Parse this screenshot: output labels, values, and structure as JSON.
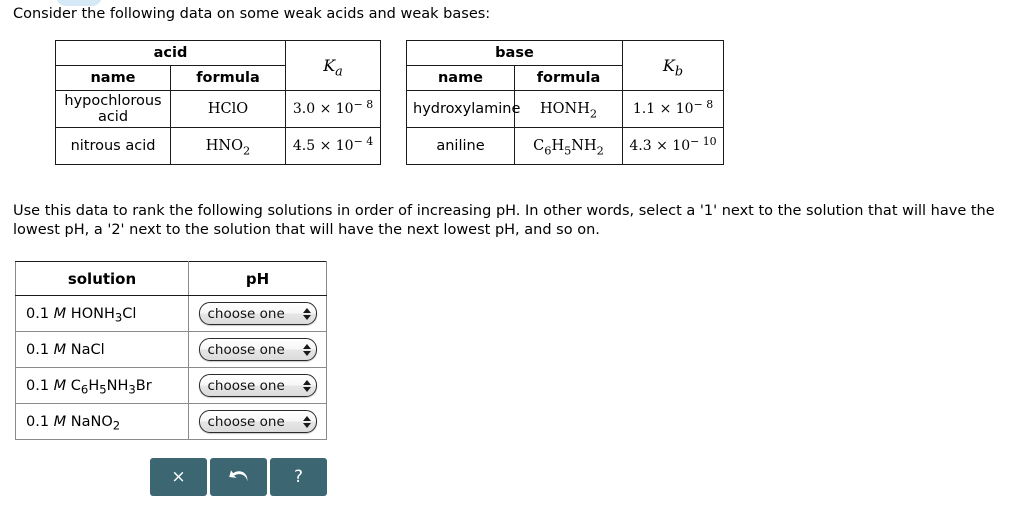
{
  "prompt": "Consider the following data on some weak acids and weak bases:",
  "acid_table": {
    "group_header": "acid",
    "columns": [
      "name",
      "formula"
    ],
    "k_header_symbol": "K",
    "k_header_subscript": "a",
    "rows": [
      {
        "name": "hypochlorous acid",
        "formula_main": "HClO",
        "formula_sub": "",
        "k_mantissa": "3.0",
        "k_times": "×",
        "k_base": "10",
        "k_exponent": "− 8"
      },
      {
        "name": "nitrous acid",
        "formula_main": "HNO",
        "formula_sub": "2",
        "k_mantissa": "4.5",
        "k_times": "×",
        "k_base": "10",
        "k_exponent": "− 4"
      }
    ]
  },
  "base_table": {
    "group_header": "base",
    "columns": [
      "name",
      "formula"
    ],
    "k_header_symbol": "K",
    "k_header_subscript": "b",
    "rows": [
      {
        "name": "hydroxylamine",
        "formula_main": "HONH",
        "formula_sub": "2",
        "k_mantissa": "1.1",
        "k_times": "×",
        "k_base": "10",
        "k_exponent": "− 8"
      },
      {
        "name": "aniline",
        "formula_main": "C",
        "formula_sub": "6",
        "formula_main2": "H",
        "formula_sub2": "5",
        "formula_main3": "NH",
        "formula_sub3": "2",
        "k_mantissa": "4.3",
        "k_times": "×",
        "k_base": "10",
        "k_exponent": "− 10"
      }
    ]
  },
  "instructions": "Use this data to rank the following solutions in order of increasing pH. In other words, select a '1' next to the solution that will have the lowest pH, a '2' next to the solution that will have the next lowest pH, and so on.",
  "solution_table": {
    "headers": [
      "solution",
      "pH"
    ],
    "rows": [
      {
        "conc": "0.1",
        "molarity": "M",
        "formula_main": "HONH",
        "formula_sub": "3",
        "formula_tail": "Cl",
        "ph_value": "choose one"
      },
      {
        "conc": "0.1",
        "molarity": "M",
        "formula_main": "NaCl",
        "formula_sub": "",
        "formula_tail": "",
        "ph_value": "choose one"
      },
      {
        "conc": "0.1",
        "molarity": "M",
        "formula_main": "C",
        "formula_sub": "6",
        "formula_mid": "H",
        "formula_sub2": "5",
        "formula_mid2": "NH",
        "formula_sub3": "3",
        "formula_tail": "Br",
        "ph_value": "choose one"
      },
      {
        "conc": "0.1",
        "molarity": "M",
        "formula_main": "NaNO",
        "formula_sub": "2",
        "formula_tail": "",
        "ph_value": "choose one"
      }
    ]
  },
  "toolbar": {
    "clear_label": "×",
    "undo_label": "undo",
    "help_label": "?",
    "button_color": "#3d6673"
  }
}
